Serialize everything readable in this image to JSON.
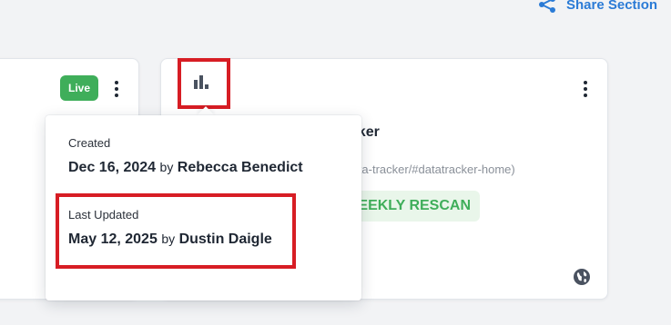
{
  "share": {
    "label": "Share Section",
    "icon": "share-icon"
  },
  "left_card": {
    "status_badge": "Live"
  },
  "right_card": {
    "title_fragment": "acker",
    "url_fragment": "-data-tracker/#datatracker-home)",
    "rescan_fragment": "EEKLY RESCAN",
    "globe_icon": "globe-icon",
    "stats_icon": "bar-chart-icon"
  },
  "popover": {
    "created_label": "Created",
    "created_date": "Dec 16, 2024",
    "created_by_word": "by",
    "created_by": "Rebecca Benedict",
    "updated_label": "Last Updated",
    "updated_date": "May 12, 2025",
    "updated_by_word": "by",
    "updated_by": "Dustin Daigle"
  },
  "colors": {
    "accent": "#2b7bd6",
    "live_green": "#3fae5a",
    "rescan_bg": "#e9f6ea",
    "highlight_red": "#d71d24"
  }
}
